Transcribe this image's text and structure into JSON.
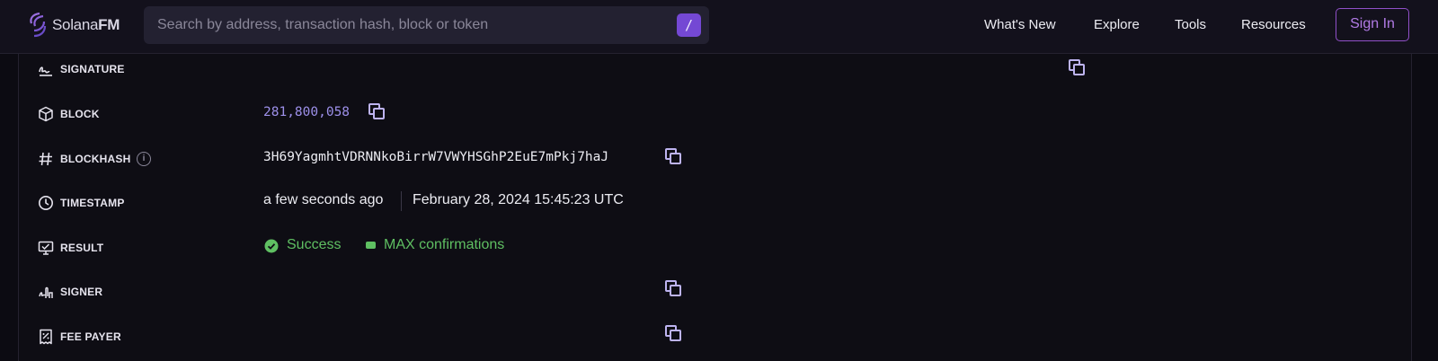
{
  "nav": {
    "logo_text_a": "Solana",
    "logo_text_b": "FM",
    "search_placeholder": "Search by address, transaction hash, block or token",
    "search_shortcut": "/",
    "links": [
      "What's New",
      "Explore",
      "Tools",
      "Resources"
    ],
    "sign_in": "Sign In"
  },
  "details": {
    "signature": {
      "label": "SIGNATURE",
      "icon": "signature-icon"
    },
    "block": {
      "label": "BLOCK",
      "value": "281,800,058",
      "icon": "cube-icon"
    },
    "blockhash": {
      "label": "BLOCKHASH",
      "value": "3H69YagmhtVDRNNkoBirrW7VWYHSGhP2EuE7mPkj7haJ",
      "icon": "hash-icon",
      "info": "i"
    },
    "timestamp": {
      "label": "TIMESTAMP",
      "relative": "a few seconds ago",
      "absolute": "February 28, 2024 15:45:23 UTC",
      "icon": "clock-icon"
    },
    "result": {
      "label": "RESULT",
      "status": "Success",
      "confirmations": "MAX confirmations",
      "icon": "monitor-check-icon",
      "status_color": "#5fbf62"
    },
    "signer": {
      "label": "SIGNER",
      "icon": "signer-icon"
    },
    "fee_payer": {
      "label": "FEE PAYER",
      "icon": "receipt-icon"
    }
  },
  "colors": {
    "accent": "#7448d4",
    "link": "#9d90ea",
    "success": "#5fbf62",
    "sign_in": "#9050c8"
  }
}
